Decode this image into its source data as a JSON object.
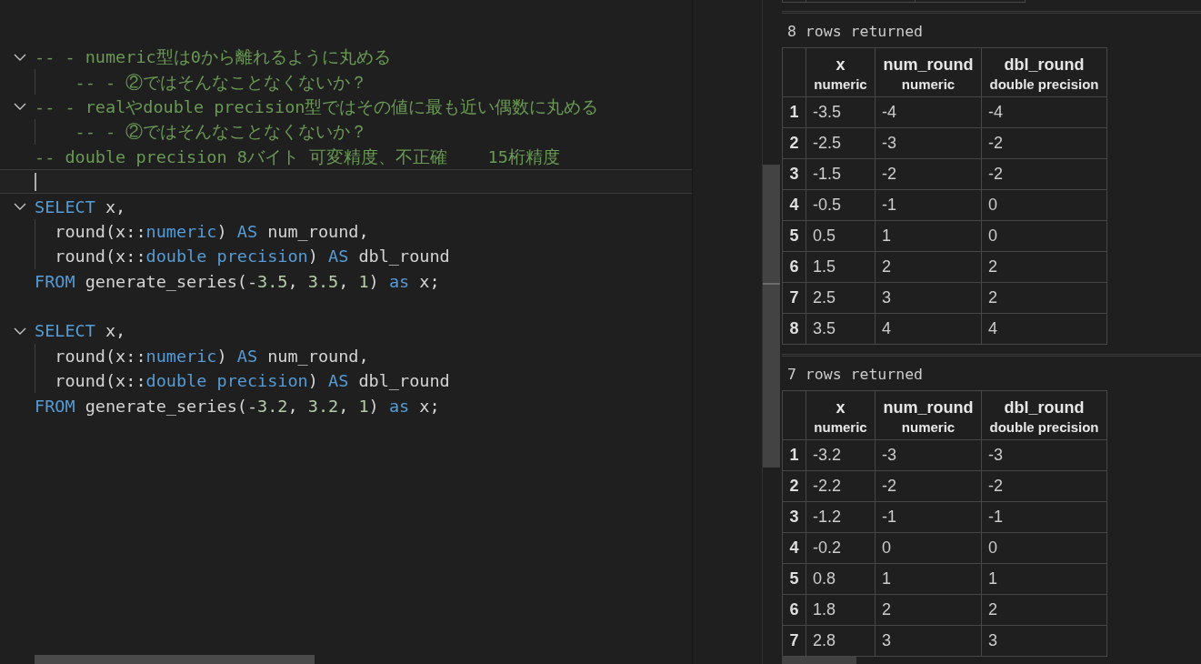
{
  "editor": {
    "lines": [
      {
        "current": false,
        "expanded": true,
        "tokens": [
          {
            "kind": "comment",
            "text": "-- - numeric型は0から離れるように丸める"
          }
        ],
        "children": [
          {
            "current": false,
            "tokens": [
              {
                "kind": "comment",
                "text": "    -- - ②ではそんなことなくないか？"
              }
            ]
          }
        ]
      },
      {
        "current": false,
        "expanded": true,
        "tokens": [
          {
            "kind": "comment",
            "text": "-- - realやdouble precision型ではその値に最も近い偶数に丸める"
          }
        ],
        "children": [
          {
            "current": false,
            "tokens": [
              {
                "kind": "comment",
                "text": "    -- - ②ではそんなことなくないか？"
              }
            ]
          }
        ]
      },
      {
        "current": false,
        "tokens": [
          {
            "kind": "comment",
            "text": "-- double precision 8バイト 可変精度、不正確    15桁精度"
          }
        ]
      },
      {
        "current": true
      },
      {
        "current": false,
        "expanded": true,
        "tokens": [
          {
            "kind": "keyword",
            "text": "SELECT"
          },
          {
            "kind": "plain",
            "text": " x,"
          }
        ],
        "children": [
          {
            "current": false,
            "tokens": [
              {
                "kind": "plain",
                "text": "  round(x::"
              },
              {
                "kind": "keyword",
                "text": "numeric"
              },
              {
                "kind": "plain",
                "text": ") "
              },
              {
                "kind": "keyword",
                "text": "AS"
              },
              {
                "kind": "plain",
                "text": " num_round,"
              }
            ]
          },
          {
            "current": false,
            "tokens": [
              {
                "kind": "plain",
                "text": "  round(x::"
              },
              {
                "kind": "keyword",
                "text": "double precision"
              },
              {
                "kind": "plain",
                "text": ") "
              },
              {
                "kind": "keyword",
                "text": "AS"
              },
              {
                "kind": "plain",
                "text": " dbl_round"
              }
            ]
          }
        ]
      },
      {
        "current": false,
        "tokens": [
          {
            "kind": "keyword",
            "text": "FROM"
          },
          {
            "kind": "plain",
            "text": " generate_series(-"
          },
          {
            "kind": "number",
            "text": "3.5"
          },
          {
            "kind": "plain",
            "text": ", "
          },
          {
            "kind": "number",
            "text": "3.5"
          },
          {
            "kind": "plain",
            "text": ", "
          },
          {
            "kind": "number",
            "text": "1"
          },
          {
            "kind": "plain",
            "text": ") "
          },
          {
            "kind": "keyword",
            "text": "as"
          },
          {
            "kind": "plain",
            "text": " x;"
          }
        ]
      },
      {
        "current": false
      },
      {
        "current": false,
        "expanded": true,
        "tokens": [
          {
            "kind": "keyword",
            "text": "SELECT"
          },
          {
            "kind": "plain",
            "text": " x,"
          }
        ],
        "children": [
          {
            "current": false,
            "tokens": [
              {
                "kind": "plain",
                "text": "  round(x::"
              },
              {
                "kind": "keyword",
                "text": "numeric"
              },
              {
                "kind": "plain",
                "text": ") "
              },
              {
                "kind": "keyword",
                "text": "AS"
              },
              {
                "kind": "plain",
                "text": " num_round,"
              }
            ]
          },
          {
            "current": false,
            "tokens": [
              {
                "kind": "plain",
                "text": "  round(x::"
              },
              {
                "kind": "keyword",
                "text": "double precision"
              },
              {
                "kind": "plain",
                "text": ") "
              },
              {
                "kind": "keyword",
                "text": "AS"
              },
              {
                "kind": "plain",
                "text": " dbl_round"
              }
            ]
          }
        ]
      },
      {
        "current": false,
        "tokens": [
          {
            "kind": "keyword",
            "text": "FROM"
          },
          {
            "kind": "plain",
            "text": " generate_series(-"
          },
          {
            "kind": "number",
            "text": "3.2"
          },
          {
            "kind": "plain",
            "text": ", "
          },
          {
            "kind": "number",
            "text": "3.2"
          },
          {
            "kind": "plain",
            "text": ", "
          },
          {
            "kind": "number",
            "text": "1"
          },
          {
            "kind": "plain",
            "text": ") "
          },
          {
            "kind": "keyword",
            "text": "as"
          },
          {
            "kind": "plain",
            "text": " x;"
          }
        ]
      }
    ]
  },
  "results": [
    {
      "kind": "clipped"
    },
    {
      "kind": "table",
      "summary": "8 rows returned",
      "columns": [
        {
          "name": "x",
          "type": "numeric"
        },
        {
          "name": "num_round",
          "type": "numeric"
        },
        {
          "name": "dbl_round",
          "type": "double precision"
        }
      ],
      "rows": [
        {
          "number": "1",
          "cells": [
            "-3.5",
            "-4",
            "-4"
          ]
        },
        {
          "number": "2",
          "cells": [
            "-2.5",
            "-3",
            "-2"
          ]
        },
        {
          "number": "3",
          "cells": [
            "-1.5",
            "-2",
            "-2"
          ]
        },
        {
          "number": "4",
          "cells": [
            "-0.5",
            "-1",
            "0"
          ]
        },
        {
          "number": "5",
          "cells": [
            "0.5",
            "1",
            "0"
          ]
        },
        {
          "number": "6",
          "cells": [
            "1.5",
            "2",
            "2"
          ]
        },
        {
          "number": "7",
          "cells": [
            "2.5",
            "3",
            "2"
          ]
        },
        {
          "number": "8",
          "cells": [
            "3.5",
            "4",
            "4"
          ]
        }
      ]
    },
    {
      "kind": "table",
      "summary": "7 rows returned",
      "columns": [
        {
          "name": "x",
          "type": "numeric"
        },
        {
          "name": "num_round",
          "type": "numeric"
        },
        {
          "name": "dbl_round",
          "type": "double precision"
        }
      ],
      "rows": [
        {
          "number": "1",
          "cells": [
            "-3.2",
            "-3",
            "-3"
          ]
        },
        {
          "number": "2",
          "cells": [
            "-2.2",
            "-2",
            "-2"
          ]
        },
        {
          "number": "3",
          "cells": [
            "-1.2",
            "-1",
            "-1"
          ]
        },
        {
          "number": "4",
          "cells": [
            "-0.2",
            "0",
            "0"
          ]
        },
        {
          "number": "5",
          "cells": [
            "0.8",
            "1",
            "1"
          ]
        },
        {
          "number": "6",
          "cells": [
            "1.8",
            "2",
            "2"
          ]
        },
        {
          "number": "7",
          "cells": [
            "2.8",
            "3",
            "3"
          ]
        }
      ]
    }
  ]
}
